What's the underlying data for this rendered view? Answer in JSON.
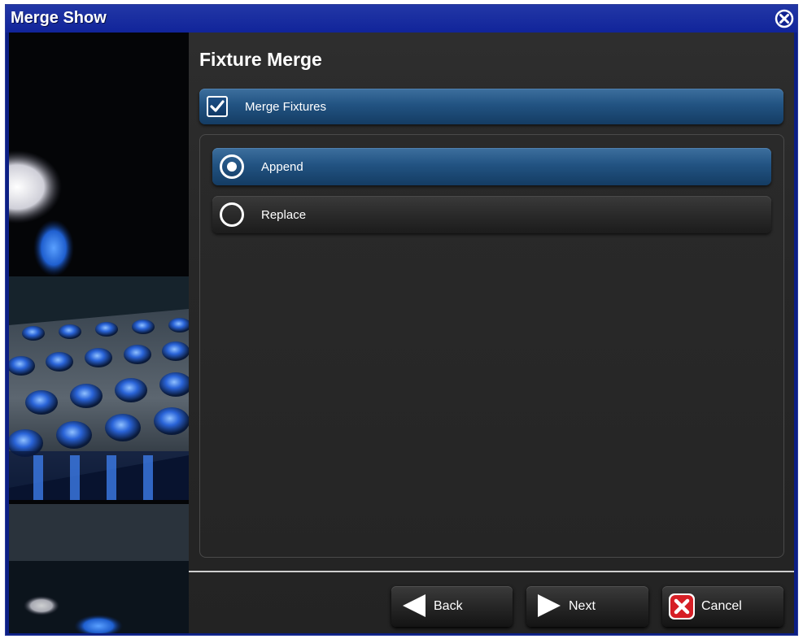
{
  "window": {
    "title": "Merge Show"
  },
  "page": {
    "heading": "Fixture Merge"
  },
  "merge_fixtures": {
    "label": "Merge Fixtures",
    "checked": true
  },
  "options": [
    {
      "label": "Append",
      "selected": true
    },
    {
      "label": "Replace",
      "selected": false
    }
  ],
  "footer": {
    "back_label": "Back",
    "next_label": "Next",
    "cancel_label": "Cancel"
  },
  "icons": {
    "close": "close-icon",
    "check": "checkmark-icon",
    "back": "arrow-left-icon",
    "next": "arrow-right-icon",
    "cancel": "cancel-x-icon"
  },
  "colors": {
    "titlebar": "#1a2d9e",
    "selected_bar": "#225382",
    "panel_bg": "#252525",
    "cancel_red": "#d61f26"
  }
}
